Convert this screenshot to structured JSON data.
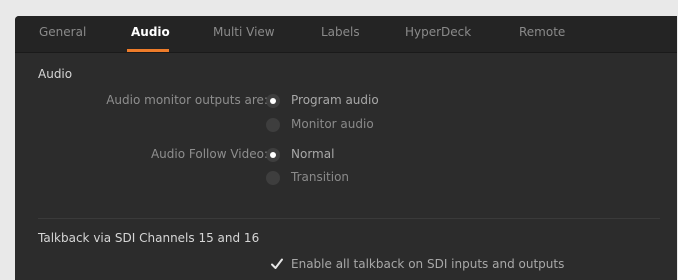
{
  "tabs": [
    {
      "label": "General",
      "active": false
    },
    {
      "label": "Audio",
      "active": true
    },
    {
      "label": "Multi View",
      "active": false
    },
    {
      "label": "Labels",
      "active": false
    },
    {
      "label": "HyperDeck",
      "active": false
    },
    {
      "label": "Remote",
      "active": false
    }
  ],
  "audio": {
    "section_title": "Audio",
    "monitor_outputs": {
      "label": "Audio monitor outputs are:",
      "options": [
        {
          "label": "Program audio",
          "selected": true
        },
        {
          "label": "Monitor audio",
          "selected": false
        }
      ]
    },
    "follow_video": {
      "label": "Audio Follow Video:",
      "options": [
        {
          "label": "Normal",
          "selected": true
        },
        {
          "label": "Transition",
          "selected": false
        }
      ]
    }
  },
  "talkback": {
    "section_title": "Talkback via SDI Channels 15 and 16",
    "checkbox_label": "Enable all talkback on SDI inputs and outputs",
    "checked": true
  },
  "colors": {
    "accent": "#ee7c2a",
    "panel": "#2c2c2c",
    "tabbar": "#242424"
  }
}
